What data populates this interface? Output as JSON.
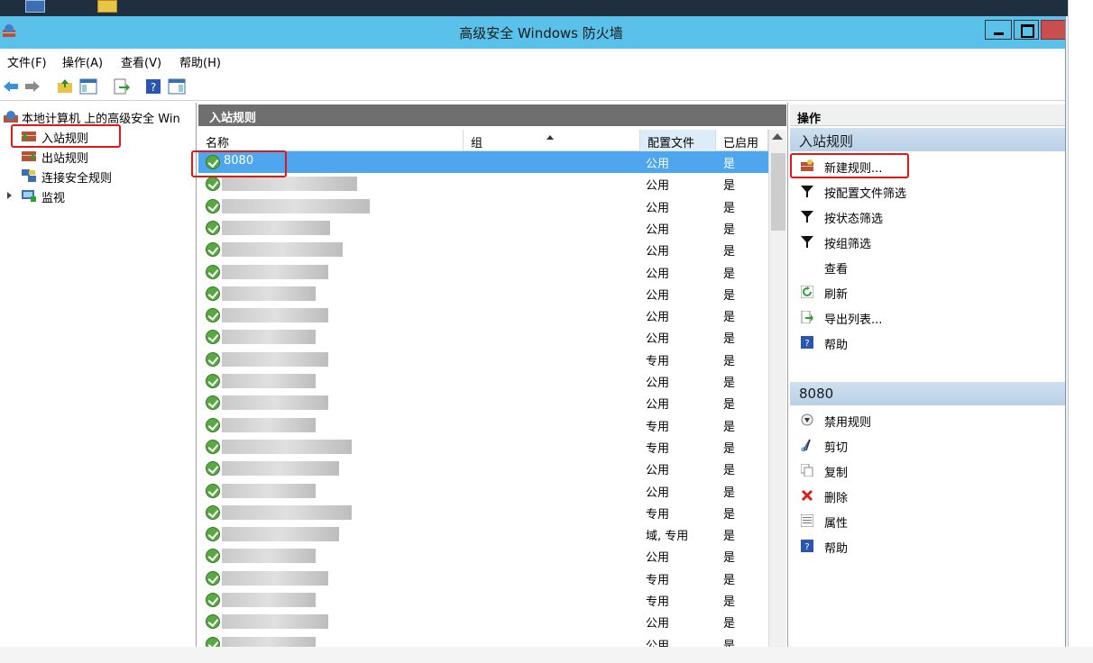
{
  "window": {
    "title": "高级安全 Windows 防火墙"
  },
  "menu": [
    "文件(F)",
    "操作(A)",
    "查看(V)",
    "帮助(H)"
  ],
  "tree": {
    "root": "本地计算机 上的高级安全 Win",
    "items": [
      "入站规则",
      "出站规则",
      "连接安全规则",
      "监视"
    ]
  },
  "center": {
    "header": "入站规则",
    "columns": {
      "name": "名称",
      "group": "组",
      "profile": "配置文件",
      "enabled": "已启用"
    },
    "rows": [
      {
        "name": "8080",
        "profile": "公用",
        "enabled": "是"
      },
      {
        "name": "",
        "profile": "公用",
        "enabled": "是"
      },
      {
        "name": "",
        "profile": "公用",
        "enabled": "是"
      },
      {
        "name": "",
        "profile": "公用",
        "enabled": "是"
      },
      {
        "name": "",
        "profile": "公用",
        "enabled": "是"
      },
      {
        "name": "",
        "profile": "公用",
        "enabled": "是"
      },
      {
        "name": "",
        "profile": "公用",
        "enabled": "是"
      },
      {
        "name": "",
        "profile": "公用",
        "enabled": "是"
      },
      {
        "name": "",
        "profile": "公用",
        "enabled": "是"
      },
      {
        "name": "",
        "profile": "专用",
        "enabled": "是"
      },
      {
        "name": "",
        "profile": "公用",
        "enabled": "是"
      },
      {
        "name": "",
        "profile": "公用",
        "enabled": "是"
      },
      {
        "name": "",
        "profile": "专用",
        "enabled": "是"
      },
      {
        "name": "",
        "profile": "专用",
        "enabled": "是"
      },
      {
        "name": "",
        "profile": "公用",
        "enabled": "是"
      },
      {
        "name": "",
        "profile": "公用",
        "enabled": "是"
      },
      {
        "name": "",
        "profile": "专用",
        "enabled": "是"
      },
      {
        "name": "",
        "profile": "域, 专用",
        "enabled": "是"
      },
      {
        "name": "",
        "profile": "公用",
        "enabled": "是"
      },
      {
        "name": "",
        "profile": "专用",
        "enabled": "是"
      },
      {
        "name": "",
        "profile": "专用",
        "enabled": "是"
      },
      {
        "name": "",
        "profile": "公用",
        "enabled": "是"
      },
      {
        "name": "",
        "profile": "公用",
        "enabled": "是"
      }
    ]
  },
  "actions": {
    "header": "操作",
    "section1": "入站规则",
    "section1_items": [
      "新建规则...",
      "按配置文件筛选",
      "按状态筛选",
      "按组筛选",
      "查看",
      "刷新",
      "导出列表...",
      "帮助"
    ],
    "section2": "8080",
    "section2_items": [
      "禁用规则",
      "剪切",
      "复制",
      "删除",
      "属性",
      "帮助"
    ]
  },
  "colors": {
    "titlebar": "#5ac1ea",
    "selection": "#4da6ee",
    "highlight": "#e01818"
  }
}
